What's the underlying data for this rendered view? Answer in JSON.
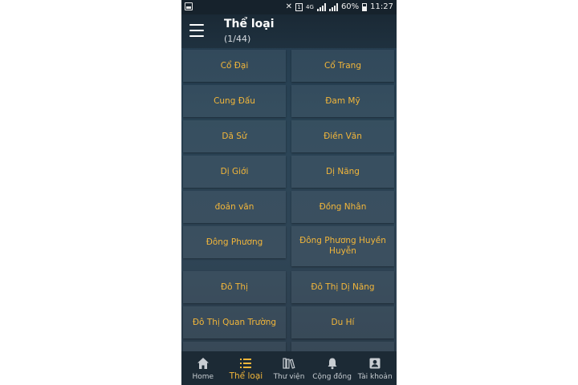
{
  "status_bar": {
    "battery_text": "60%",
    "time": "11:27",
    "network_label": "4G",
    "sim_label": "1"
  },
  "app_bar": {
    "title": "Thể loại",
    "subtitle": "(1/44)",
    "menu_icon": "hamburger-menu-icon"
  },
  "categories": [
    "Cổ Đại",
    "Cổ Trang",
    "Cung Đấu",
    "Đam Mỹ",
    "Dã Sử",
    "Điền Văn",
    "Dị Giới",
    "Dị Năng",
    "đoản văn",
    "Đồng Nhân",
    "Đông Phương",
    "Đông Phương Huyền Huyễn",
    "Đô Thị",
    "Đô Thị Dị Năng",
    "Đô Thị Quan Trường",
    "Du Hí"
  ],
  "bottom_nav": [
    {
      "label": "Home",
      "icon": "home-icon",
      "active": false
    },
    {
      "label": "Thể loại",
      "icon": "list-icon",
      "active": true
    },
    {
      "label": "Thư viện",
      "icon": "library-icon",
      "active": false
    },
    {
      "label": "Cộng đồng",
      "icon": "bell-icon",
      "active": false
    },
    {
      "label": "Tài khoản",
      "icon": "account-icon",
      "active": false
    }
  ],
  "colors": {
    "accent": "#f2b63a",
    "nav_inactive": "#c8cdd2",
    "background": "#2b4557"
  }
}
